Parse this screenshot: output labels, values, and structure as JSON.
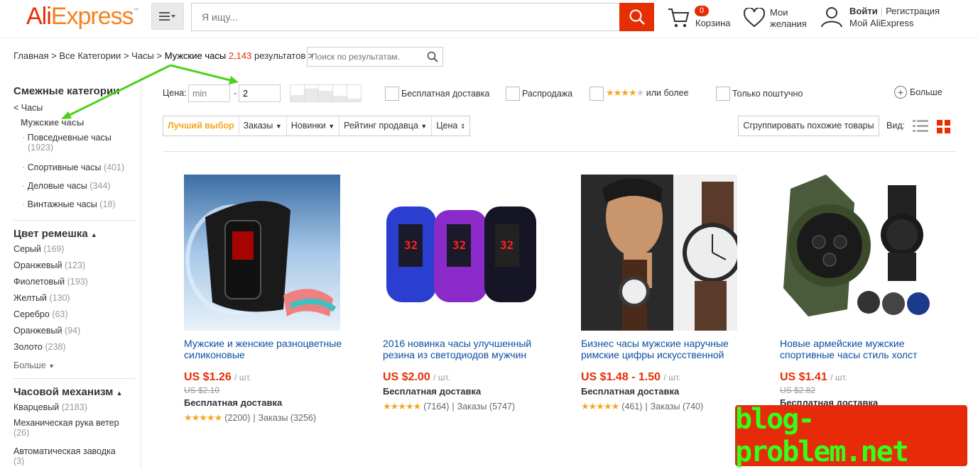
{
  "header": {
    "logo_part1": "Ali",
    "logo_part2": "Express",
    "search_placeholder": "Я ищу...",
    "cart_count": "0",
    "cart_label": "Корзина",
    "wishlist_label_1": "Мои",
    "wishlist_label_2": "желания",
    "signin": "Войти",
    "register": "Регистрация",
    "my_account": "Мой AliExpress"
  },
  "breadcrumb": {
    "home": "Главная",
    "all_categories": "Все Категории",
    "watches": "Часы",
    "current": "Мужские часы",
    "count": "2,143",
    "results": "результатов",
    "search_placeholder": "Поиск по результатам."
  },
  "sidebar": {
    "related_title": "Смежные категории",
    "parent": "< Часы",
    "current": "Мужские часы",
    "subcategories": [
      {
        "label": "Повседневные часы",
        "count": "(1923)"
      },
      {
        "label": "Спортивные часы",
        "count": "(401)"
      },
      {
        "label": "Деловые часы",
        "count": "(344)"
      },
      {
        "label": "Винтажные часы",
        "count": "(18)"
      }
    ],
    "strap_title": "Цвет ремешка",
    "strap_colors": [
      {
        "label": "Серый",
        "count": "(169)"
      },
      {
        "label": "Оранжевый",
        "count": "(123)"
      },
      {
        "label": "Фиолетовый",
        "count": "(193)"
      },
      {
        "label": "Желтый",
        "count": "(130)"
      },
      {
        "label": "Серебро",
        "count": "(63)"
      },
      {
        "label": "Оранжевый",
        "count": "(94)"
      },
      {
        "label": "Золото",
        "count": "(238)"
      }
    ],
    "more": "Больше",
    "movement_title": "Часовой механизм",
    "movements": [
      {
        "label": "Кварцевый",
        "count": "(2183)"
      },
      {
        "label": "Механическая рука ветер",
        "count": "(26)"
      },
      {
        "label": "Автоматическая заводка",
        "count": "(3)"
      }
    ]
  },
  "filters": {
    "price_label": "Цена:",
    "price_min_placeholder": "min",
    "price_max_value": "2",
    "free_shipping": "Бесплатная доставка",
    "sale": "Распродажа",
    "rating_suffix": "или более",
    "rating_stars": 4,
    "single_item": "Только поштучно",
    "more": "Больше"
  },
  "sort": {
    "best": "Лучший выбор",
    "orders": "Заказы",
    "newest": "Новинки",
    "seller_rating": "Рейтинг продавца",
    "price": "Цена",
    "group_similar": "Сгруппировать похожие товары",
    "view_label": "Вид:"
  },
  "products": [
    {
      "title": "Мужские и женские разноцветные силиконовые",
      "price": "US $1.26",
      "unit": "/ шт.",
      "old_price": "US $2.10",
      "shipping": "Бесплатная доставка",
      "reviews": "(2200)",
      "orders": "Заказы (3256)"
    },
    {
      "title": "2016 новинка часы улучшенный резина из светодиодов мужчин",
      "price": "US $2.00",
      "unit": "/ шт.",
      "old_price": "",
      "shipping": "Бесплатная доставка",
      "reviews": "(7164)",
      "orders": "Заказы (5747)"
    },
    {
      "title": "Бизнес часы мужские наручные римские цифры искусственной",
      "price": "US $1.48 - 1.50",
      "unit": "/ шт.",
      "old_price": "",
      "shipping": "Бесплатная доставка",
      "reviews": "(461)",
      "orders": "Заказы (740)"
    },
    {
      "title": "Новые армейские мужские спортивные часы стиль холст",
      "price": "US $1.41",
      "unit": "/ шт.",
      "old_price": "US $2.82",
      "shipping": "Бесплатная доставка",
      "reviews": "",
      "orders": ""
    }
  ],
  "watermark": "blog-problem.net",
  "colors": {
    "brand_red": "#e62e04",
    "brand_orange": "#f5821f",
    "link_blue": "#0b4ea2",
    "star": "#f5a623"
  }
}
